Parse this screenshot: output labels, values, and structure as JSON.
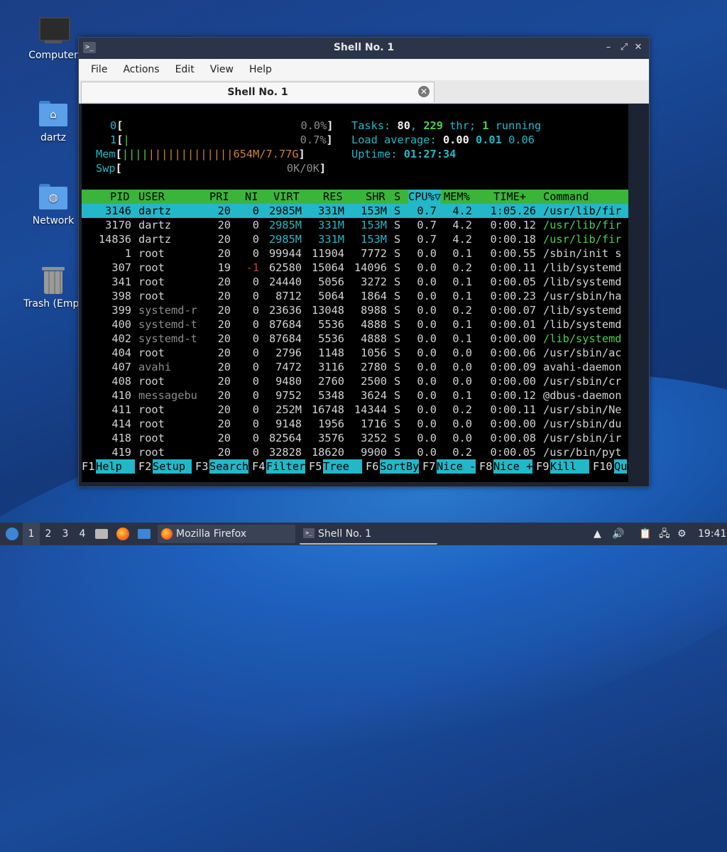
{
  "desktop": {
    "icons": [
      {
        "label": "Computer"
      },
      {
        "label": "dartz"
      },
      {
        "label": "Network"
      },
      {
        "label": "Trash (Empt"
      }
    ]
  },
  "window": {
    "title": "Shell No. 1",
    "menu": [
      "File",
      "Actions",
      "Edit",
      "View",
      "Help"
    ],
    "tab_label": "Shell No. 1"
  },
  "htop": {
    "cpu0": {
      "num": "0",
      "pct": "0.0%"
    },
    "cpu1": {
      "num": "1",
      "pct": "0.7%"
    },
    "mem": {
      "label": "Mem",
      "value": "654M/7.77G"
    },
    "swp": {
      "label": "Swp",
      "value": "0K/0K"
    },
    "tasks": {
      "label": "Tasks:",
      "count": "80",
      "thr": "229",
      "thr_label": "thr;",
      "running": "1",
      "running_label": "running"
    },
    "load": {
      "label": "Load average:",
      "v1": "0.00",
      "v5": "0.01",
      "v15": "0.06"
    },
    "uptime": {
      "label": "Uptime:",
      "value": "01:27:34"
    },
    "columns": [
      "PID",
      "USER",
      "PRI",
      "NI",
      "VIRT",
      "RES",
      "SHR",
      "S",
      "CPU%▽",
      "MEM%",
      "TIME+",
      "Command"
    ],
    "processes": [
      {
        "pid": "3146",
        "user": "dartz",
        "pri": "20",
        "ni": "0",
        "virt": "2985M",
        "res": "331M",
        "shr": "153M",
        "s": "S",
        "cpu": "0.7",
        "mem": "4.2",
        "time": "1:05.26",
        "cmd": "/usr/lib/fir"
      },
      {
        "pid": "3170",
        "user": "dartz",
        "pri": "20",
        "ni": "0",
        "virt": "2985M",
        "res": "331M",
        "shr": "153M",
        "s": "S",
        "cpu": "0.7",
        "mem": "4.2",
        "time": "0:00.12",
        "cmd": "/usr/lib/fir"
      },
      {
        "pid": "14836",
        "user": "dartz",
        "pri": "20",
        "ni": "0",
        "virt": "2985M",
        "res": "331M",
        "shr": "153M",
        "s": "S",
        "cpu": "0.7",
        "mem": "4.2",
        "time": "0:00.18",
        "cmd": "/usr/lib/fir"
      },
      {
        "pid": "1",
        "user": "root",
        "pri": "20",
        "ni": "0",
        "virt": "99944",
        "res": "11904",
        "shr": "7772",
        "s": "S",
        "cpu": "0.0",
        "mem": "0.1",
        "time": "0:00.55",
        "cmd": "/sbin/init s"
      },
      {
        "pid": "307",
        "user": "root",
        "pri": "19",
        "ni": "-1",
        "virt": "62580",
        "res": "15064",
        "shr": "14096",
        "s": "S",
        "cpu": "0.0",
        "mem": "0.2",
        "time": "0:00.11",
        "cmd": "/lib/systemd"
      },
      {
        "pid": "341",
        "user": "root",
        "pri": "20",
        "ni": "0",
        "virt": "24440",
        "res": "5056",
        "shr": "3272",
        "s": "S",
        "cpu": "0.0",
        "mem": "0.1",
        "time": "0:00.05",
        "cmd": "/lib/systemd"
      },
      {
        "pid": "398",
        "user": "root",
        "pri": "20",
        "ni": "0",
        "virt": "8712",
        "res": "5064",
        "shr": "1864",
        "s": "S",
        "cpu": "0.0",
        "mem": "0.1",
        "time": "0:00.23",
        "cmd": "/usr/sbin/ha"
      },
      {
        "pid": "399",
        "user": "systemd-r",
        "pri": "20",
        "ni": "0",
        "virt": "23636",
        "res": "13048",
        "shr": "8988",
        "s": "S",
        "cpu": "0.0",
        "mem": "0.2",
        "time": "0:00.07",
        "cmd": "/lib/systemd"
      },
      {
        "pid": "400",
        "user": "systemd-t",
        "pri": "20",
        "ni": "0",
        "virt": "87684",
        "res": "5536",
        "shr": "4888",
        "s": "S",
        "cpu": "0.0",
        "mem": "0.1",
        "time": "0:00.01",
        "cmd": "/lib/systemd"
      },
      {
        "pid": "402",
        "user": "systemd-t",
        "pri": "20",
        "ni": "0",
        "virt": "87684",
        "res": "5536",
        "shr": "4888",
        "s": "S",
        "cpu": "0.0",
        "mem": "0.1",
        "time": "0:00.00",
        "cmd": "/lib/systemd"
      },
      {
        "pid": "404",
        "user": "root",
        "pri": "20",
        "ni": "0",
        "virt": "2796",
        "res": "1148",
        "shr": "1056",
        "s": "S",
        "cpu": "0.0",
        "mem": "0.0",
        "time": "0:00.06",
        "cmd": "/usr/sbin/ac"
      },
      {
        "pid": "407",
        "user": "avahi",
        "pri": "20",
        "ni": "0",
        "virt": "7472",
        "res": "3116",
        "shr": "2780",
        "s": "S",
        "cpu": "0.0",
        "mem": "0.0",
        "time": "0:00.09",
        "cmd": "avahi-daemon"
      },
      {
        "pid": "408",
        "user": "root",
        "pri": "20",
        "ni": "0",
        "virt": "9480",
        "res": "2760",
        "shr": "2500",
        "s": "S",
        "cpu": "0.0",
        "mem": "0.0",
        "time": "0:00.00",
        "cmd": "/usr/sbin/cr"
      },
      {
        "pid": "410",
        "user": "messagebu",
        "pri": "20",
        "ni": "0",
        "virt": "9752",
        "res": "5348",
        "shr": "3624",
        "s": "S",
        "cpu": "0.0",
        "mem": "0.1",
        "time": "0:00.12",
        "cmd": "@dbus-daemon"
      },
      {
        "pid": "411",
        "user": "root",
        "pri": "20",
        "ni": "0",
        "virt": "252M",
        "res": "16748",
        "shr": "14344",
        "s": "S",
        "cpu": "0.0",
        "mem": "0.2",
        "time": "0:00.11",
        "cmd": "/usr/sbin/Ne"
      },
      {
        "pid": "414",
        "user": "root",
        "pri": "20",
        "ni": "0",
        "virt": "9148",
        "res": "1956",
        "shr": "1716",
        "s": "S",
        "cpu": "0.0",
        "mem": "0.0",
        "time": "0:00.00",
        "cmd": "/usr/sbin/du"
      },
      {
        "pid": "418",
        "user": "root",
        "pri": "20",
        "ni": "0",
        "virt": "82564",
        "res": "3576",
        "shr": "3252",
        "s": "S",
        "cpu": "0.0",
        "mem": "0.0",
        "time": "0:00.08",
        "cmd": "/usr/sbin/ir"
      },
      {
        "pid": "419",
        "user": "root",
        "pri": "20",
        "ni": "0",
        "virt": "32828",
        "res": "18620",
        "shr": "9900",
        "s": "S",
        "cpu": "0.0",
        "mem": "0.2",
        "time": "0:00.05",
        "cmd": "/usr/bin/pyt"
      }
    ],
    "fkeys": [
      {
        "key": "F1",
        "label": "Help  "
      },
      {
        "key": "F2",
        "label": "Setup "
      },
      {
        "key": "F3",
        "label": "Search"
      },
      {
        "key": "F4",
        "label": "Filter"
      },
      {
        "key": "F5",
        "label": "Tree  "
      },
      {
        "key": "F6",
        "label": "SortBy"
      },
      {
        "key": "F7",
        "label": "Nice -"
      },
      {
        "key": "F8",
        "label": "Nice +"
      },
      {
        "key": "F9",
        "label": "Kill  "
      },
      {
        "key": "F10",
        "label": "Qu"
      }
    ]
  },
  "taskbar": {
    "workspaces": [
      "1",
      "2",
      "3",
      "4"
    ],
    "tasks": [
      {
        "label": "Mozilla Firefox"
      },
      {
        "label": "Shell No. 1"
      }
    ],
    "clock": "19:41"
  }
}
